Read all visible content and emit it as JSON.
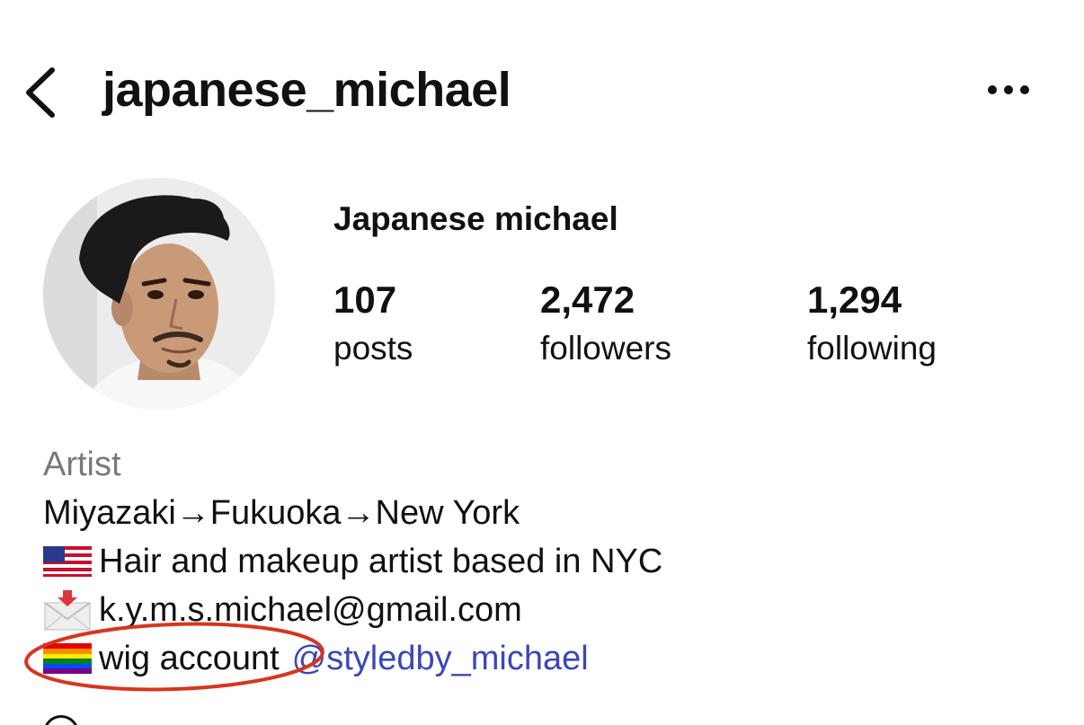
{
  "header": {
    "username": "japanese_michael",
    "back_icon": "chevron-left-icon",
    "more_icon": "more-horizontal-icon"
  },
  "profile": {
    "display_name": "Japanese michael",
    "stats": {
      "posts": {
        "value": "107",
        "label": "posts"
      },
      "followers": {
        "value": "2,472",
        "label": "followers"
      },
      "following": {
        "value": "1,294",
        "label": "following"
      }
    }
  },
  "bio": {
    "category": "Artist",
    "line1": "Miyazaki→Fukuoka→New York",
    "line2_icon": "us-flag-icon",
    "line2": "Hair and makeup artist based in NYC",
    "line3_icon": "incoming-envelope-icon",
    "line3": "k.y.m.s.michael@gmail.com",
    "line4_icon": "rainbow-flag-icon",
    "line4": "wig account",
    "line4_mention": "@styledby_michael"
  },
  "colors": {
    "text": "#111111",
    "category": "#737b80",
    "mention_link": "#3a47b8",
    "annotation_circle": "#d9341f"
  }
}
